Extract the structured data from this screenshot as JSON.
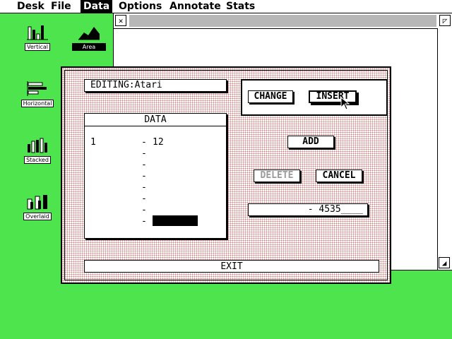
{
  "menubar": {
    "items": [
      {
        "label": "Desk",
        "active": false
      },
      {
        "label": "File",
        "active": false
      },
      {
        "label": "Data",
        "active": true
      },
      {
        "label": "Options",
        "active": false
      },
      {
        "label": "Annotate",
        "active": false
      },
      {
        "label": "Stats",
        "active": false
      }
    ]
  },
  "desktop": {
    "icons": [
      {
        "label": "Vertical",
        "icon": "vertical-bar-chart-icon"
      },
      {
        "label": "Area",
        "icon": "area-chart-icon"
      },
      {
        "label": "Horizontal",
        "icon": "horizontal-bar-chart-icon"
      },
      {
        "label": "Stacked",
        "icon": "stacked-bar-chart-icon"
      },
      {
        "label": "Overlaid",
        "icon": "overlaid-bar-chart-icon"
      }
    ]
  },
  "window": {
    "close_glyph": "✕",
    "full_glyph": "◸",
    "resize_glyph": "◢"
  },
  "dialog": {
    "editing_label": "EDITING:Atari",
    "data_header": "DATA",
    "rows": [
      {
        "index": "1",
        "dash": "-",
        "value": "12"
      },
      {
        "index": "",
        "dash": "-",
        "value": ""
      },
      {
        "index": "",
        "dash": "-",
        "value": ""
      },
      {
        "index": "",
        "dash": "-",
        "value": ""
      },
      {
        "index": "",
        "dash": "-",
        "value": ""
      },
      {
        "index": "",
        "dash": "-",
        "value": ""
      },
      {
        "index": "",
        "dash": "-",
        "value": ""
      },
      {
        "index": "",
        "dash": "-",
        "value": ""
      }
    ],
    "change_label": "CHANGE",
    "insert_label": "INSERT",
    "add_label": "ADD",
    "delete_label": "DELETE",
    "cancel_label": "CANCEL",
    "entry_value": "- 4535____",
    "exit_label": "EXIT"
  },
  "colors": {
    "desktop": "#4ee44e",
    "dialog_pattern": "#d08080"
  }
}
